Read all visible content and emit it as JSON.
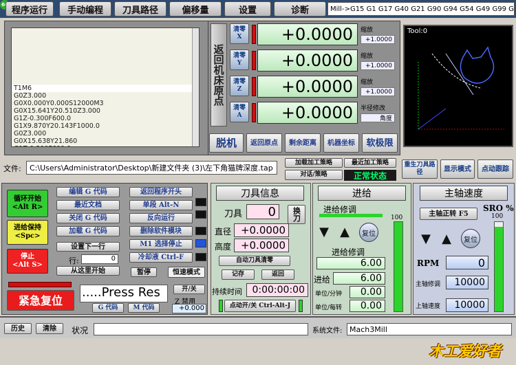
{
  "tabs": [
    "程序运行",
    "手动编程",
    "刀具路径",
    "偏移量",
    "设置",
    "诊断"
  ],
  "logo_badge": "60",
  "gcodes": "Mill->G15  G1 G17 G40 G21 G90 G94 G54 G49 G99 G64 G97",
  "gcode_lines": [
    "T1M6",
    "G0Z3.000",
    "G0X0.000Y0.000S12000M3",
    "G0X15.641Y20.510Z3.000",
    "G1Z-0.300F600.0",
    "G1X9.870Y20.143F1000.0",
    "G0Z3.000",
    "G0X15.638Y21.860",
    "G1Z-0.300F600.0"
  ],
  "axes": [
    {
      "zero": "清零",
      "axis": "X",
      "value": "+0.0000",
      "scale_label": "缩放",
      "scale": "+1.0000"
    },
    {
      "zero": "清零",
      "axis": "Y",
      "value": "+0.0000",
      "scale_label": "缩放",
      "scale": "+1.0000"
    },
    {
      "zero": "清零",
      "axis": "Z",
      "value": "+0.0000",
      "scale_label": "缩放",
      "scale": "+1.0000"
    },
    {
      "zero": "清零",
      "axis": "A",
      "value": "+0.0000",
      "scale_label": "半径修改",
      "scale": "角度"
    }
  ],
  "ref_home": "返回机床原点",
  "tool_view": "Tool:0",
  "row_buttons": {
    "offline": "脱机",
    "home": "返回原点",
    "dist": "剩余距离",
    "machine": "机器坐标",
    "softlimit": "软极限"
  },
  "file_label": "文件:",
  "file_path": "C:\\Users\\Administrator\\Desktop\\新建文件夹 (3)\\左下角猫牌深度.tap",
  "strategy": {
    "add": "加载加工策略",
    "recent": "最近加工策略",
    "dialog": "对话/策略",
    "status": "正常状态"
  },
  "right_buttons": {
    "regen": "重生刀具路径",
    "display": "显示模式",
    "follow": "点动跟踪"
  },
  "cycle": {
    "start": "循环开始",
    "start_key": "<Alt R>",
    "hold": "进给保持",
    "hold_key": "<Spc>",
    "stop": "停止",
    "stop_key": "<Alt S>"
  },
  "edit_buttons": [
    "编辑 G 代码",
    "最近文档",
    "关闭 G 代码",
    "加载 G 代码"
  ],
  "set_next": "设置下一行",
  "line_label": "行:",
  "line_value": "0",
  "run_from": "从这里开始",
  "run_buttons": [
    "返回程序开头",
    "单段 Alt-N",
    "反向运行",
    "删除软件模块",
    "M1 选择停止",
    "冷却液 Ctrl-F"
  ],
  "pause": "暂停",
  "vel_mode": "恒速模式",
  "reset": "紧急复位",
  "gm_label": {
    "g": "G 代码",
    "m": "M 代码"
  },
  "press_text": ".....Press Res",
  "open_close": "开/关",
  "z_inhibit": "Z 禁用",
  "z_inhibit_val": "+0.000",
  "tool": {
    "title": "刀具信息",
    "tool_label": "刀具",
    "tool_val": "0",
    "change": "换刀",
    "dia_label": "直径",
    "dia": "+0.0000",
    "h_label": "高度",
    "h": "+0.0000",
    "auto_zero": "自动刀具清零",
    "remember": "记存",
    "return": "返回",
    "dwell_label": "持续时间",
    "dwell": "0:00:00:00",
    "jog": "点动开/关 Ctrl-Alt-J"
  },
  "feed": {
    "title": "进给",
    "override": "进给修调",
    "override2": "进给修调",
    "pct": "100",
    "override_val": "6.00",
    "feed_label": "进给",
    "feed_val": "6.00",
    "upm_label": "单位/分钟",
    "upm": "0.00",
    "upr_label": "单位/每转",
    "upr": "0.00",
    "reset": "复位",
    "meter": 1.0
  },
  "spindle": {
    "title": "主轴速度",
    "cw": "主轴正转 F5",
    "sro": "SRO %",
    "pct": "100",
    "reset": "复位",
    "rpm_label": "RPM",
    "rpm": "0",
    "ovr_label": "主轴修调",
    "ovr": "10000",
    "speed_label": "上轴速度",
    "speed": "10000",
    "meter": 0.95
  },
  "status": {
    "history": "历史",
    "clear": "清除",
    "status_label": "状况",
    "status": "",
    "sys_label": "系统文件:",
    "sys": "Mach3Mill"
  },
  "brand": "木工爱好者",
  "colors": {
    "cycle_start": "#33cc33",
    "hold": "#eeee44",
    "stop": "#ee2222",
    "reset": "#e81c1c",
    "led_red": "#d01010",
    "meter": "#2bd42b"
  }
}
